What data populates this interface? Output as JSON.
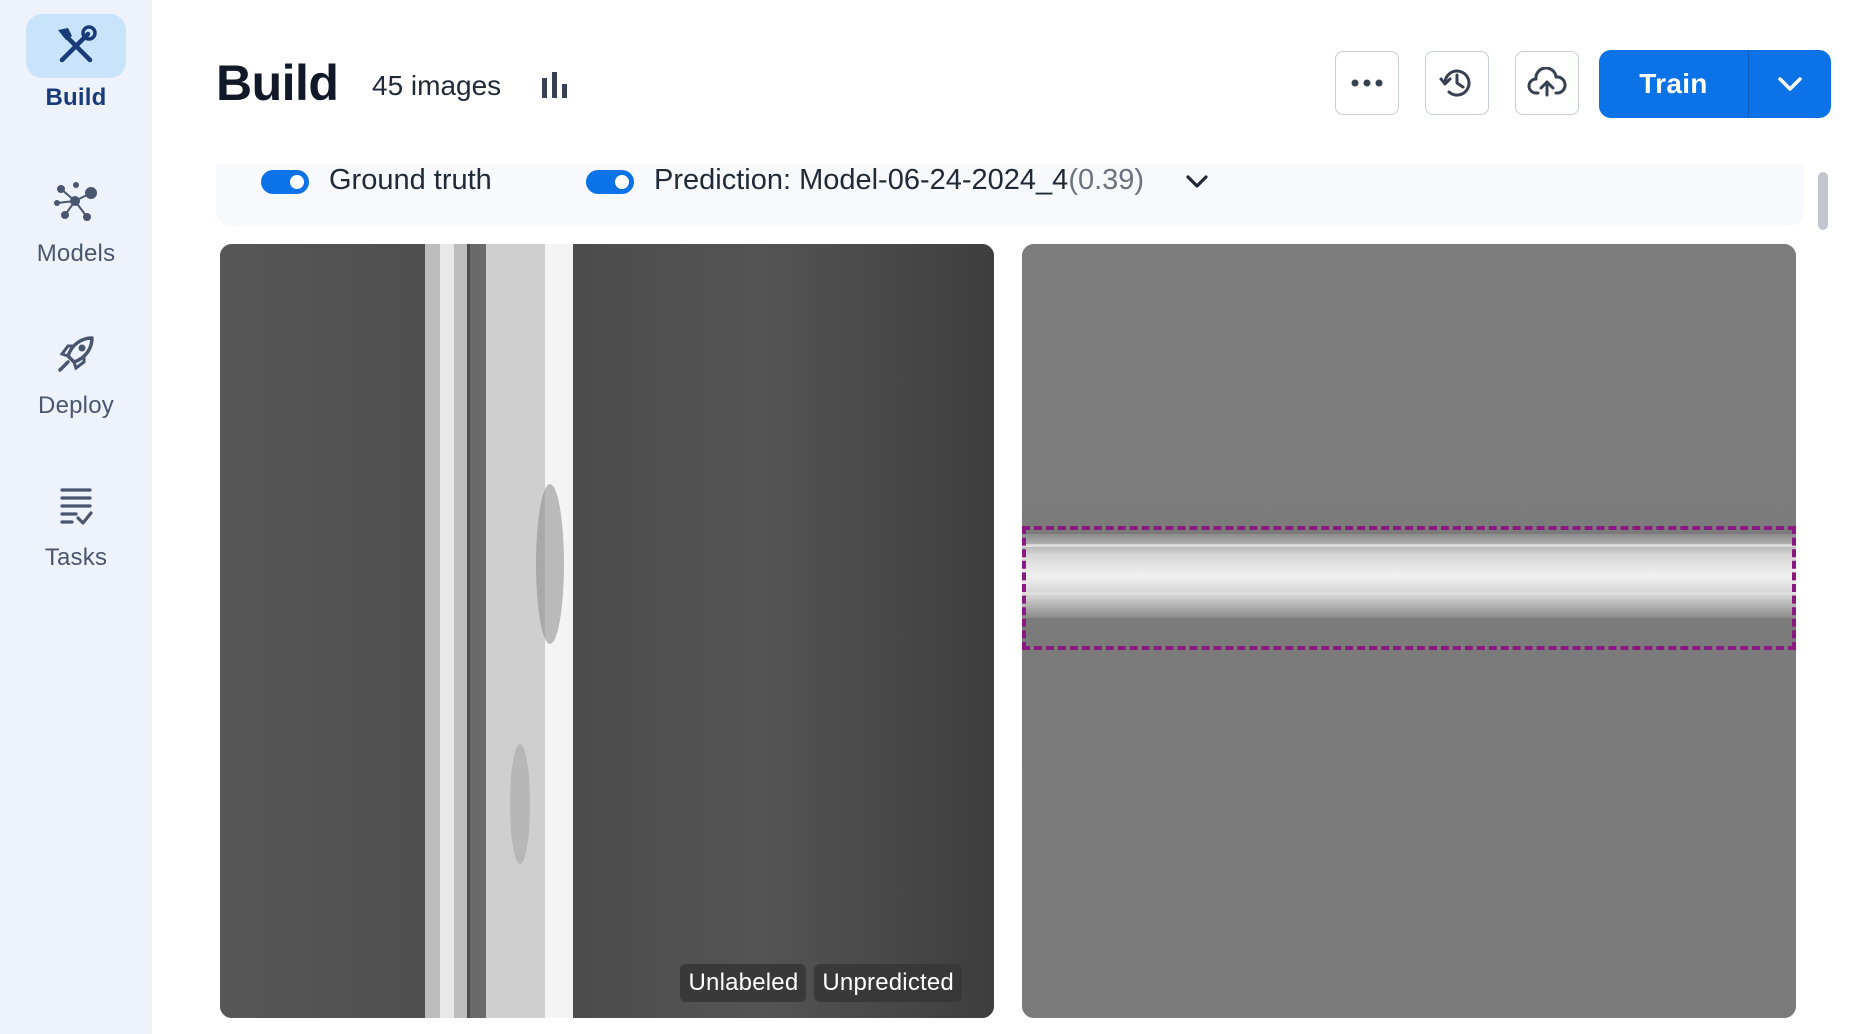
{
  "sidebar": {
    "items": [
      {
        "label": "Build",
        "icon": "build-tools-icon",
        "active": true
      },
      {
        "label": "Models",
        "icon": "models-network-icon",
        "active": false
      },
      {
        "label": "Deploy",
        "icon": "rocket-icon",
        "active": false
      },
      {
        "label": "Tasks",
        "icon": "tasks-list-icon",
        "active": false
      }
    ]
  },
  "header": {
    "title": "Build",
    "image_count": "45 images",
    "buttons": {
      "more": "more-options-icon",
      "history": "history-icon",
      "upload": "cloud-upload-icon",
      "train_label": "Train"
    }
  },
  "toggles": {
    "ground_truth": {
      "label": "Ground truth",
      "enabled": true
    },
    "prediction": {
      "label": "Prediction: Model-06-24-2024_4",
      "score": "(0.39)",
      "enabled": true
    }
  },
  "images": [
    {
      "badges": [
        "Unlabeled",
        "Unpredicted"
      ]
    },
    {
      "badges": []
    }
  ],
  "colors": {
    "accent": "#0b72e7",
    "sidebar_bg": "#eef3fb",
    "active_nav_bg": "#c9e3fb",
    "prediction_box": "#8a1a82"
  }
}
